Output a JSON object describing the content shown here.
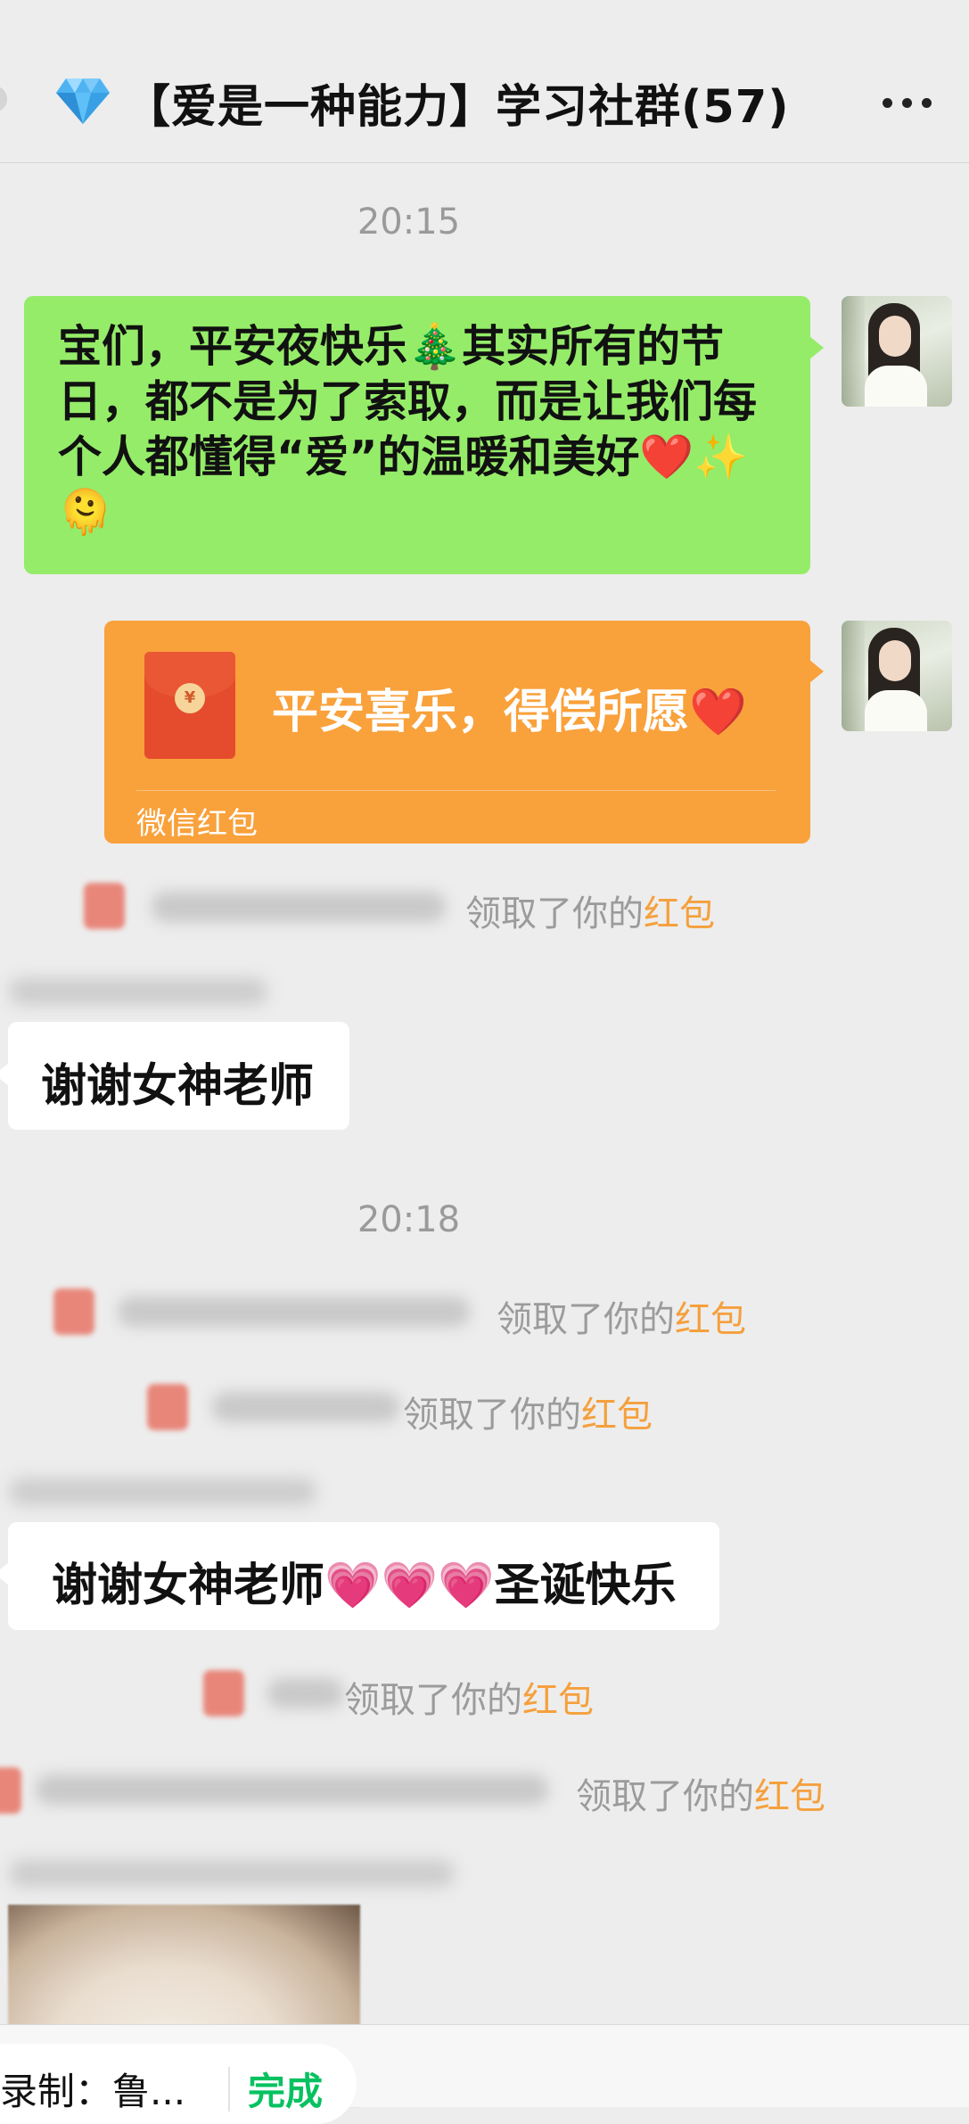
{
  "header": {
    "title": "【爱是一种能力】学习社群(57)",
    "title_icon": "diamond-icon",
    "more_icon": "more-icon"
  },
  "messages": {
    "time_1": "20:15",
    "green_text": "宝们，平安夜快乐🎄其实所有的节日，都不是为了索取，而是让我们每个人都懂得“爱”的温暖和美好❤️✨🫠",
    "redpacket": {
      "title": "平安喜乐，得偿所愿❤️",
      "footer": "微信红包"
    },
    "sys_1": {
      "prefix": "领取了你的",
      "highlight": "红包"
    },
    "reply_1": "谢谢女神老师",
    "time_2": "20:18",
    "sys_2": {
      "prefix": "领取了你的",
      "highlight": "红包"
    },
    "sys_3": {
      "prefix": "领取了你的",
      "highlight": "红包"
    },
    "reply_2": "谢谢女神老师💗💗💗圣诞快乐",
    "sys_4": {
      "prefix": "领取了你的",
      "highlight": "红包"
    },
    "sys_5": {
      "prefix": "领取了你的",
      "highlight": "红包"
    }
  },
  "bottom": {
    "recording_label": "录制：鲁...",
    "done_label": "完成"
  },
  "colors": {
    "bubble_green": "#95ec69",
    "redpacket_orange": "#f9a13b",
    "highlight_orange": "#f5a03d",
    "done_green": "#07c160"
  }
}
